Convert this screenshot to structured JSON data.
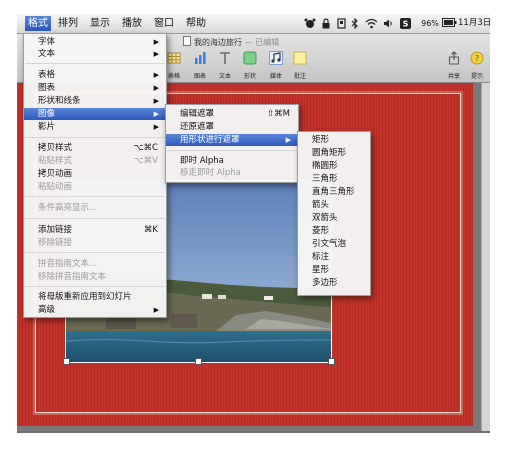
{
  "menubar": {
    "items": [
      "格式",
      "排列",
      "显示",
      "播放",
      "窗口",
      "帮助"
    ],
    "status": {
      "battery": "96%",
      "time": "11月3日"
    }
  },
  "window": {
    "title": "我的海边旅行",
    "edited": "— 已编辑",
    "toolbar": [
      "表格",
      "图表",
      "文本",
      "形状",
      "媒体",
      "批注",
      "共享",
      "提示"
    ]
  },
  "format_menu": {
    "items": [
      "字体",
      "文本",
      "表格",
      "图表",
      "形状和线条",
      "图像",
      "影片",
      "拷贝样式",
      "粘贴样式",
      "拷贝动画",
      "粘贴动画",
      "条件高亮显示...",
      "添加链接",
      "移除链接",
      "拼音指南文本...",
      "移除拼音指南文本",
      "将母版重新应用到幻灯片",
      "高级"
    ],
    "shortcuts": {
      "copy_style": "⌥⌘C",
      "paste_style": "⌥⌘V",
      "add_link": "⌘K"
    }
  },
  "image_submenu": {
    "items": [
      "编辑遮罩",
      "还原遮罩",
      "用形状进行遮罩",
      "即时 Alpha",
      "移走即时 Alpha"
    ],
    "edit_mask_shortcut": "⇧⌘M"
  },
  "shape_submenu": {
    "items": [
      "矩形",
      "圆角矩形",
      "椭圆形",
      "三角形",
      "直角三角形",
      "箭头",
      "双箭头",
      "菱形",
      "引文气泡",
      "标注",
      "星形",
      "多边形"
    ]
  },
  "colors": {
    "highlight": "#2d59bd",
    "slide_red": "#bf322a"
  }
}
